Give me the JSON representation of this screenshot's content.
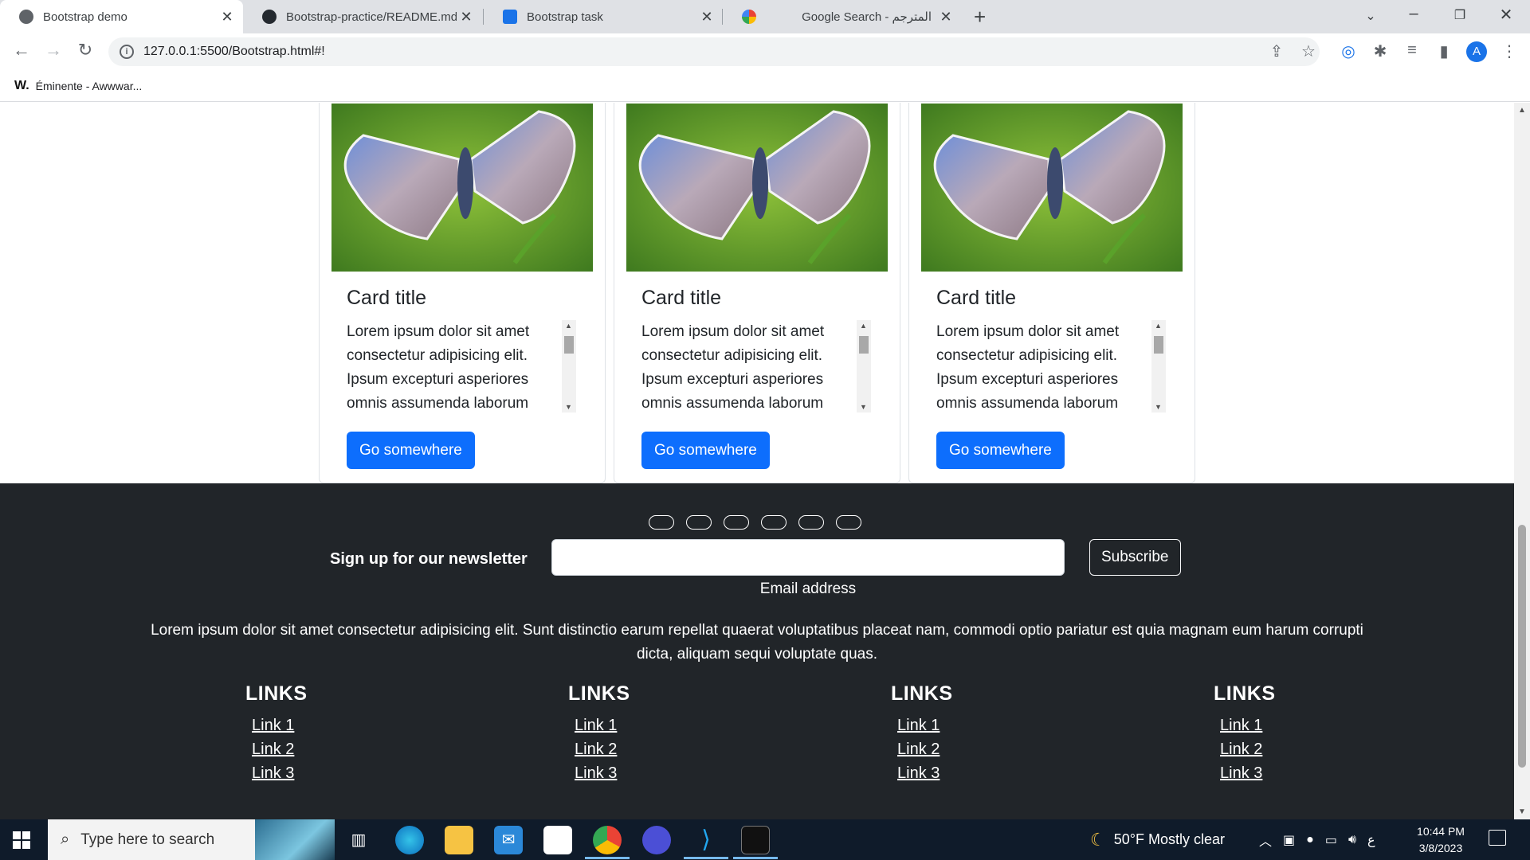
{
  "browser": {
    "tabs": [
      {
        "title": "Bootstrap demo",
        "active": true
      },
      {
        "title": "Bootstrap-practice/README.md",
        "active": false
      },
      {
        "title": "Bootstrap task",
        "active": false
      },
      {
        "title": "Google Search - المترجم",
        "active": false
      }
    ],
    "url": "127.0.0.1:5500/Bootstrap.html#!",
    "bookmark": {
      "icon": "W.",
      "label": "Éminente - Awwwar..."
    },
    "profile_initial": "A"
  },
  "cards": [
    {
      "title": "Card title",
      "text": "Lorem ipsum dolor sit amet consectetur adipisicing elit. Ipsum excepturi asperiores omnis assumenda laborum",
      "button": "Go somewhere"
    },
    {
      "title": "Card title",
      "text": "Lorem ipsum dolor sit amet consectetur adipisicing elit. Ipsum excepturi asperiores omnis assumenda laborum",
      "button": "Go somewhere"
    },
    {
      "title": "Card title",
      "text": "Lorem ipsum dolor sit amet consectetur adipisicing elit. Ipsum excepturi asperiores omnis assumenda laborum",
      "button": "Go somewhere"
    }
  ],
  "footer": {
    "newsletter_label": "Sign up for our newsletter",
    "email_help": "Email address",
    "subscribe": "Subscribe",
    "lorem": "Lorem ipsum dolor sit amet consectetur adipisicing elit. Sunt distinctio earum repellat quaerat voluptatibus placeat nam, commodi optio pariatur est quia magnam eum harum corrupti dicta, aliquam sequi voluptate quas.",
    "link_columns": [
      {
        "heading": "LINKS",
        "links": [
          "Link 1",
          "Link 2",
          "Link 3"
        ]
      },
      {
        "heading": "LINKS",
        "links": [
          "Link 1",
          "Link 2",
          "Link 3"
        ]
      },
      {
        "heading": "LINKS",
        "links": [
          "Link 1",
          "Link 2",
          "Link 3"
        ]
      },
      {
        "heading": "LINKS",
        "links": [
          "Link 1",
          "Link 2",
          "Link 3"
        ]
      }
    ]
  },
  "taskbar": {
    "search_placeholder": "Type here to search",
    "weather": "50°F  Mostly clear",
    "time": "10:44 PM",
    "date": "3/8/2023",
    "lang": "ع"
  }
}
